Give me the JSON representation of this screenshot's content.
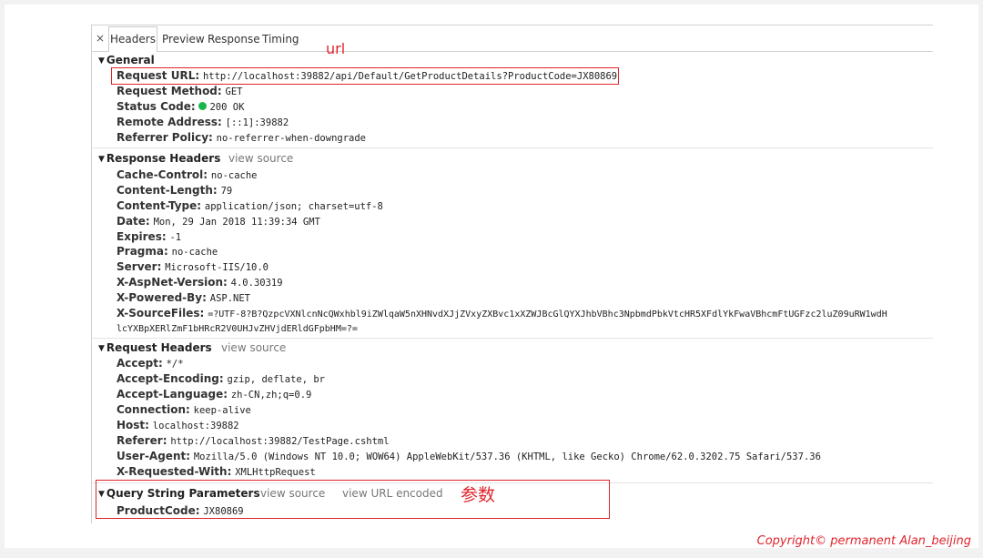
{
  "tabs": [
    "Headers",
    "Preview",
    "Response",
    "Timing"
  ],
  "close_glyph": "×",
  "annotations": {
    "url": "url",
    "params": "参数"
  },
  "general": {
    "title": "General",
    "rows": [
      {
        "key": "Request URL:",
        "value": "http://localhost:39882/api/Default/GetProductDetails?ProductCode=JX80869"
      },
      {
        "key": "Request Method:",
        "value": "GET"
      },
      {
        "key": "Status Code:",
        "value": "200 OK"
      },
      {
        "key": "Remote Address:",
        "value": "[::1]:39882"
      },
      {
        "key": "Referrer Policy:",
        "value": "no-referrer-when-downgrade"
      }
    ]
  },
  "response_headers": {
    "title": "Response Headers",
    "view_source": "view source",
    "rows": [
      {
        "key": "Cache-Control:",
        "value": "no-cache"
      },
      {
        "key": "Content-Length:",
        "value": "79"
      },
      {
        "key": "Content-Type:",
        "value": "application/json; charset=utf-8"
      },
      {
        "key": "Date:",
        "value": "Mon, 29 Jan 2018 11:39:34 GMT"
      },
      {
        "key": "Expires:",
        "value": "-1"
      },
      {
        "key": "Pragma:",
        "value": "no-cache"
      },
      {
        "key": "Server:",
        "value": "Microsoft-IIS/10.0"
      },
      {
        "key": "X-AspNet-Version:",
        "value": "4.0.30319"
      },
      {
        "key": "X-Powered-By:",
        "value": "ASP.NET"
      },
      {
        "key": "X-SourceFiles:",
        "value": "=?UTF-8?B?QzpcVXNlcnNcQWxhbl9iZWlqaW5nXHNvdXJjZVxyZXBvc1xXZWJBcGlQYXJhbVBhc3NpbmdPbkVtcHR5XFdlYkFwaVBhcmFtUGFzc2luZ09uRW1wdH"
      },
      {
        "key": "",
        "value": "lcYXBpXERlZmF1bHRcR2V0UHJvZHVjdERldGFpbHM=?="
      }
    ]
  },
  "request_headers": {
    "title": "Request Headers",
    "view_source": "view source",
    "rows": [
      {
        "key": "Accept:",
        "value": "*/*"
      },
      {
        "key": "Accept-Encoding:",
        "value": "gzip, deflate, br"
      },
      {
        "key": "Accept-Language:",
        "value": "zh-CN,zh;q=0.9"
      },
      {
        "key": "Connection:",
        "value": "keep-alive"
      },
      {
        "key": "Host:",
        "value": "localhost:39882"
      },
      {
        "key": "Referer:",
        "value": "http://localhost:39882/TestPage.cshtml"
      },
      {
        "key": "User-Agent:",
        "value": "Mozilla/5.0 (Windows NT 10.0; WOW64) AppleWebKit/537.36 (KHTML, like Gecko) Chrome/62.0.3202.75 Safari/537.36"
      },
      {
        "key": "X-Requested-With:",
        "value": "XMLHttpRequest"
      }
    ]
  },
  "query_string": {
    "title": "Query String Parameters",
    "view_source": "view source",
    "view_url_encoded": "view URL encoded",
    "rows": [
      {
        "key": "ProductCode:",
        "value": "JX80869"
      }
    ]
  },
  "copyright": "Copyright© permanent  Alan_beijing",
  "colors": {
    "annotation_red": "#e0242b",
    "status_green": "#1ab54a"
  }
}
